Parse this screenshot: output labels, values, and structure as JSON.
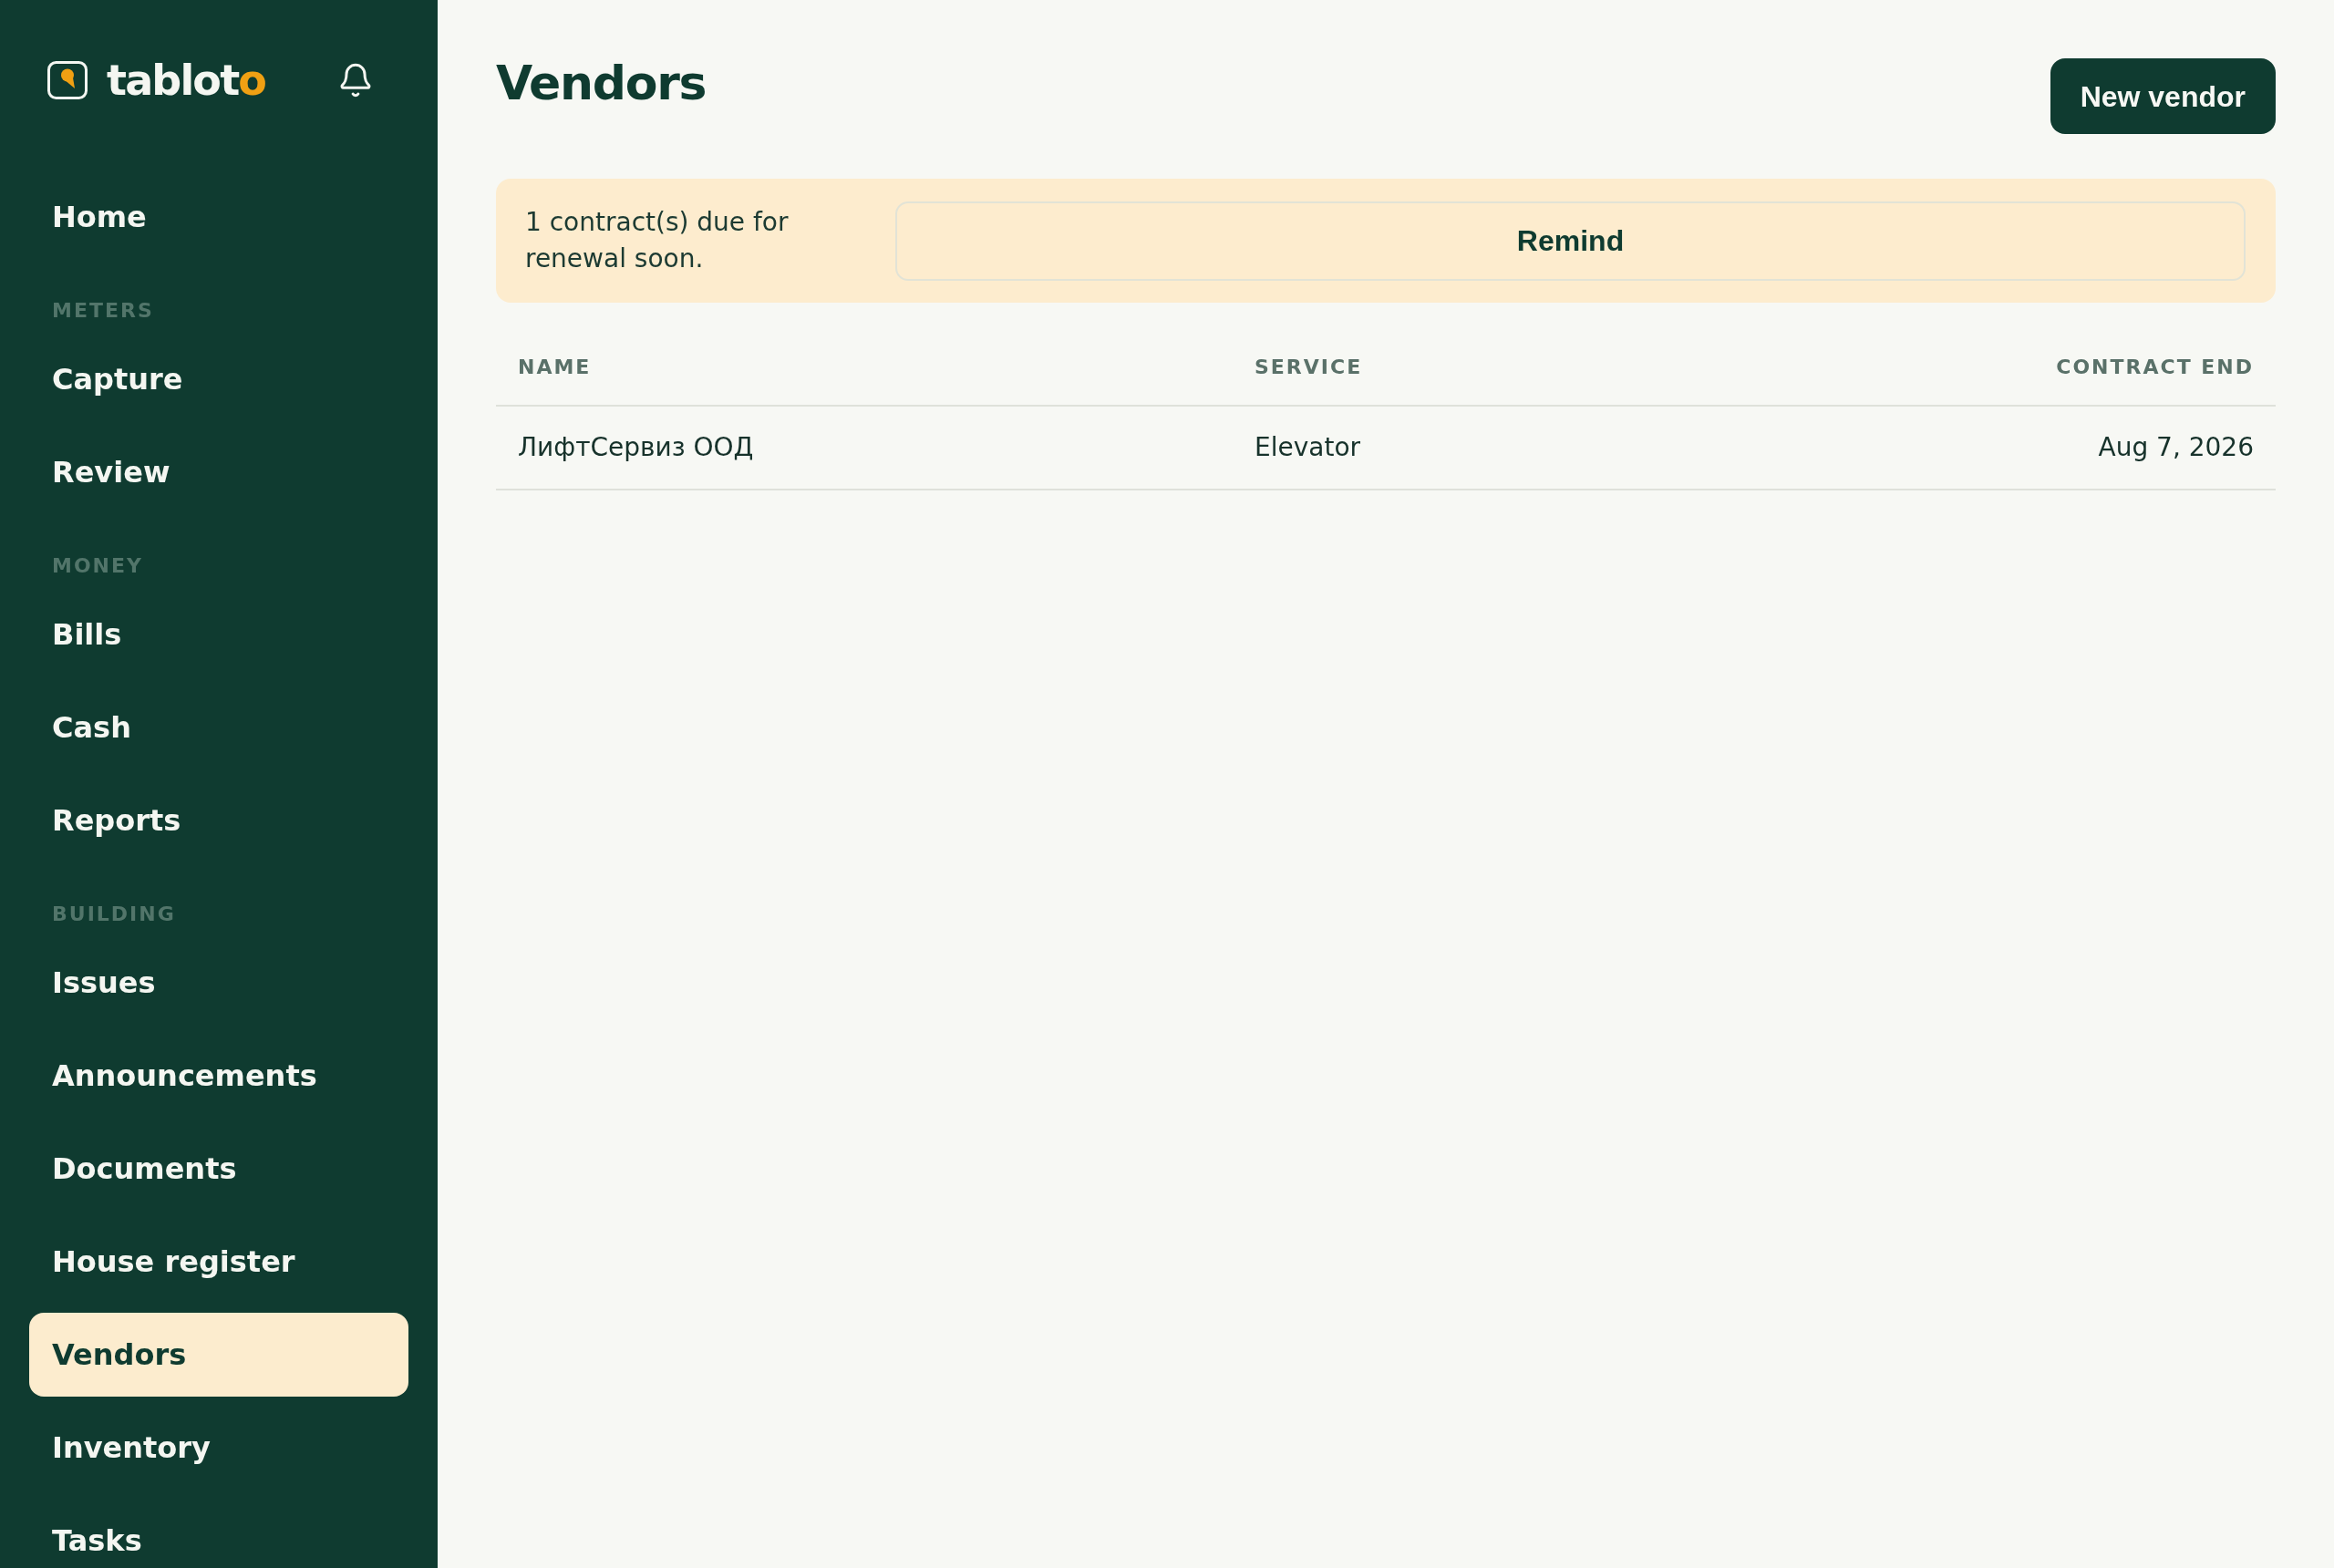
{
  "sidebar": {
    "logo": {
      "text": "tablot",
      "accent_text": "o"
    },
    "nav": [
      {
        "kind": "item",
        "label": "Home",
        "selected": false
      },
      {
        "kind": "section",
        "label": "METERS"
      },
      {
        "kind": "item",
        "label": "Capture",
        "selected": false
      },
      {
        "kind": "item",
        "label": "Review",
        "selected": false
      },
      {
        "kind": "section",
        "label": "MONEY"
      },
      {
        "kind": "item",
        "label": "Bills",
        "selected": false
      },
      {
        "kind": "item",
        "label": "Cash",
        "selected": false
      },
      {
        "kind": "item",
        "label": "Reports",
        "selected": false
      },
      {
        "kind": "section",
        "label": "BUILDING"
      },
      {
        "kind": "item",
        "label": "Issues",
        "selected": false
      },
      {
        "kind": "item",
        "label": "Announcements",
        "selected": false
      },
      {
        "kind": "item",
        "label": "Documents",
        "selected": false
      },
      {
        "kind": "item",
        "label": "House register",
        "selected": false
      },
      {
        "kind": "item",
        "label": "Vendors",
        "selected": true
      },
      {
        "kind": "item",
        "label": "Inventory",
        "selected": false
      },
      {
        "kind": "item",
        "label": "Tasks",
        "selected": false
      }
    ]
  },
  "page": {
    "title": "Vendors",
    "primary_action": "New vendor"
  },
  "renewal_banner": {
    "message": "1 contract(s) due for renewal soon.",
    "action": "Remind"
  },
  "table": {
    "columns": [
      "NAME",
      "SERVICE",
      "CONTRACT END"
    ],
    "rows": [
      [
        "ЛифтСервиз ООД",
        "Elevator",
        "Aug 7, 2026"
      ]
    ]
  }
}
